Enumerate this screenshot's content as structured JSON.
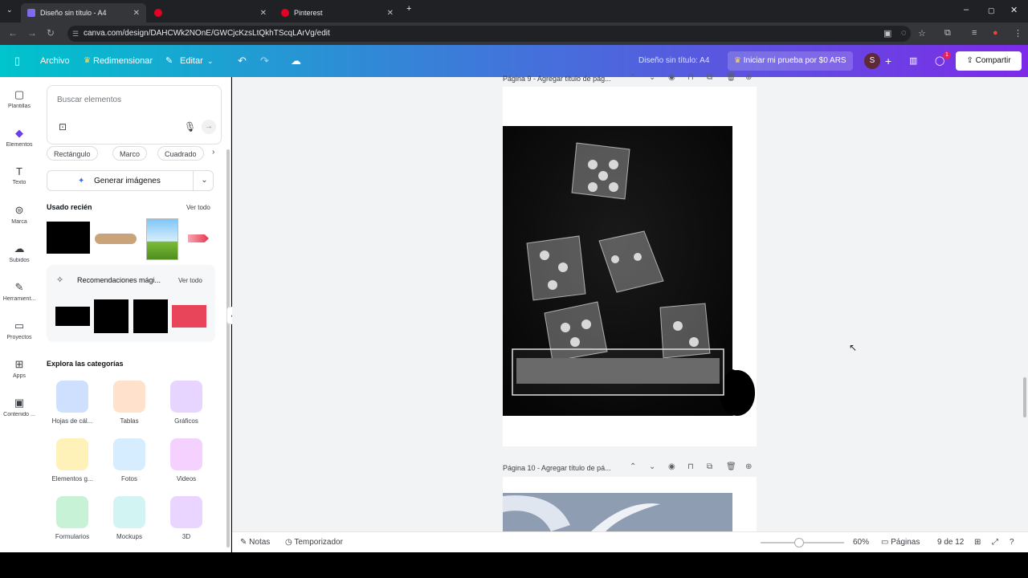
{
  "browser": {
    "tabs": [
      {
        "label": "Diseño sin título - A4",
        "active": true
      },
      {
        "label": "",
        "active": false
      },
      {
        "label": "Pinterest",
        "active": false
      }
    ],
    "new_tab": "+",
    "url": "canva.com/design/DAHCWk2NOnE/GWCjcKzsLtQkhTScqLArVg/edit"
  },
  "toolbar": {
    "archivo": "Archivo",
    "redimensionar": "Redimensionar",
    "editar": "Editar",
    "doc_title": "Diseño sin título: A4",
    "trial": "Iniciar mi prueba por $0 ARS",
    "avatar_letter": "S",
    "comments_badge": "1",
    "share": "Compartir"
  },
  "rail": [
    {
      "label": "Plantillas",
      "icon": "templates-icon",
      "glyph": "▢"
    },
    {
      "label": "Elementos",
      "icon": "elements-icon",
      "glyph": "◆"
    },
    {
      "label": "Texto",
      "icon": "text-icon",
      "glyph": "T"
    },
    {
      "label": "Marca",
      "icon": "brand-icon",
      "glyph": "⊜"
    },
    {
      "label": "Subidos",
      "icon": "uploads-icon",
      "glyph": "☁"
    },
    {
      "label": "Herramient...",
      "icon": "tools-icon",
      "glyph": "✎"
    },
    {
      "label": "Proyectos",
      "icon": "projects-icon",
      "glyph": "▭"
    },
    {
      "label": "Apps",
      "icon": "apps-icon",
      "glyph": "⊞"
    },
    {
      "label": "Contenido ...",
      "icon": "content-icon",
      "glyph": "▣"
    }
  ],
  "panel": {
    "search_placeholder": "Buscar elementos",
    "chips": [
      "Rectángulo",
      "Marco",
      "Cuadrado"
    ],
    "generate": "Generar imágenes",
    "recent_title": "Usado recién",
    "see_all": "Ver todo",
    "magic_title": "Recomendaciones mági...",
    "magic_see_all": "Ver todo",
    "explore_title": "Explora las categorías",
    "categories": [
      {
        "label": "Hojas de cál...",
        "color": "#cfe0ff"
      },
      {
        "label": "Tablas",
        "color": "#ffe1cc"
      },
      {
        "label": "Gráficos",
        "color": "#e7d5ff"
      },
      {
        "label": "Elementos g...",
        "color": "#fff2b8"
      },
      {
        "label": "Fotos",
        "color": "#d6ecff"
      },
      {
        "label": "Videos",
        "color": "#f5d1ff"
      },
      {
        "label": "Formularios",
        "color": "#c8f2d6"
      },
      {
        "label": "Mockups",
        "color": "#d2f5f3"
      },
      {
        "label": "3D",
        "color": "#e9d5ff"
      }
    ]
  },
  "pages": {
    "page9_title": "Página 9 - Agregar título de pág...",
    "page10_title": "Página 10 - Agregar título de pá..."
  },
  "bottom": {
    "notes": "Notas",
    "timer": "Temporizador",
    "zoom": "60%",
    "pages": "Páginas",
    "page_count": "9 de 12"
  }
}
